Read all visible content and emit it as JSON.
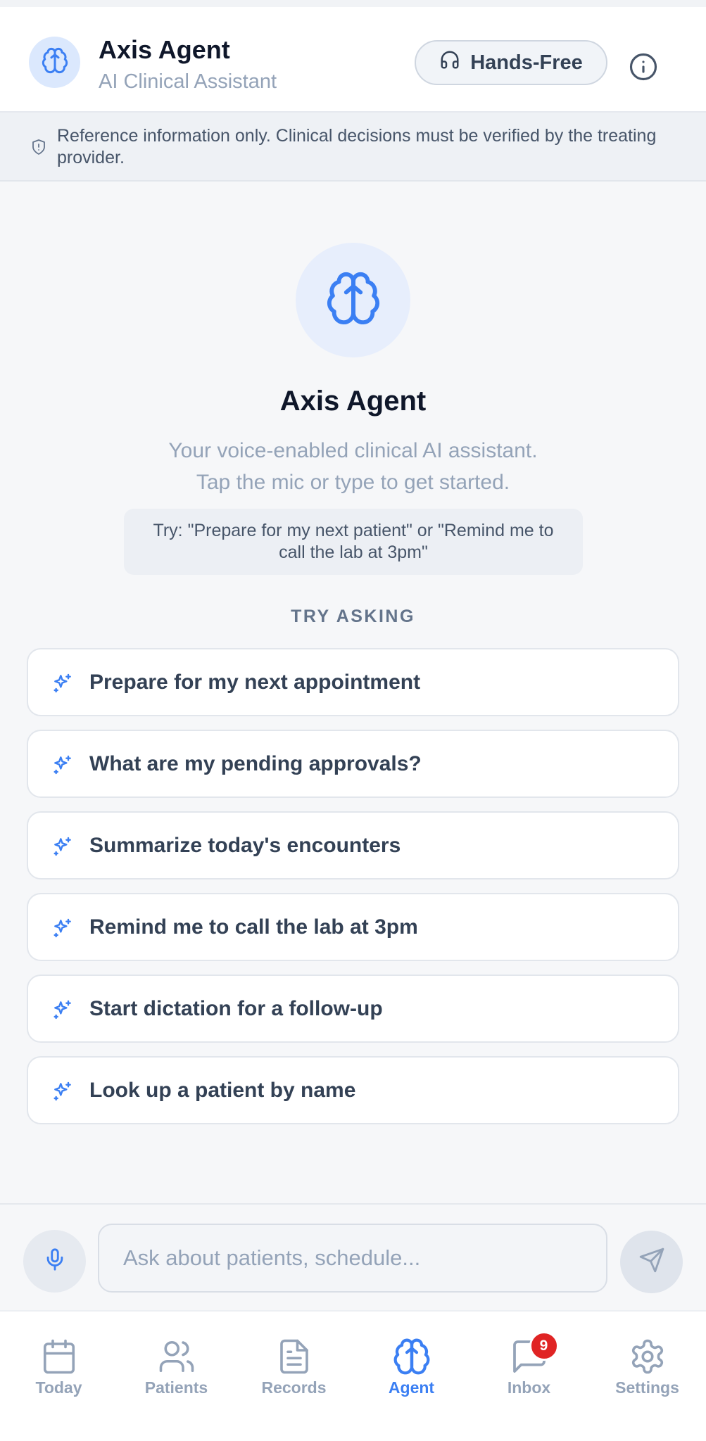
{
  "header": {
    "title": "Axis Agent",
    "subtitle": "AI Clinical Assistant",
    "hands_free_label": "Hands-Free"
  },
  "disclaimer": {
    "text": "Reference information only. Clinical decisions must be verified by the treating provider."
  },
  "hero": {
    "title": "Axis Agent",
    "description_line1": "Your voice-enabled clinical AI assistant.",
    "description_line2": "Tap the mic or type to get started.",
    "try_hint": "Try: \"Prepare for my next patient\" or \"Remind me to call the lab at 3pm\""
  },
  "suggestions": {
    "section_label": "TRY ASKING",
    "items": [
      {
        "label": "Prepare for my next appointment"
      },
      {
        "label": "What are my pending approvals?"
      },
      {
        "label": "Summarize today's encounters"
      },
      {
        "label": "Remind me to call the lab at 3pm"
      },
      {
        "label": "Start dictation for a follow-up"
      },
      {
        "label": "Look up a patient by name"
      }
    ]
  },
  "composer": {
    "placeholder": "Ask about patients, schedule...",
    "value": ""
  },
  "nav": {
    "items": [
      {
        "label": "Today",
        "icon": "calendar-icon"
      },
      {
        "label": "Patients",
        "icon": "users-icon"
      },
      {
        "label": "Records",
        "icon": "document-icon"
      },
      {
        "label": "Agent",
        "icon": "brain-icon",
        "active": true
      },
      {
        "label": "Inbox",
        "icon": "chat-icon",
        "badge": "9"
      },
      {
        "label": "Settings",
        "icon": "gear-icon"
      }
    ]
  },
  "colors": {
    "accent": "#3b7ff3",
    "badge": "#e02424",
    "muted": "#94a3b8"
  }
}
